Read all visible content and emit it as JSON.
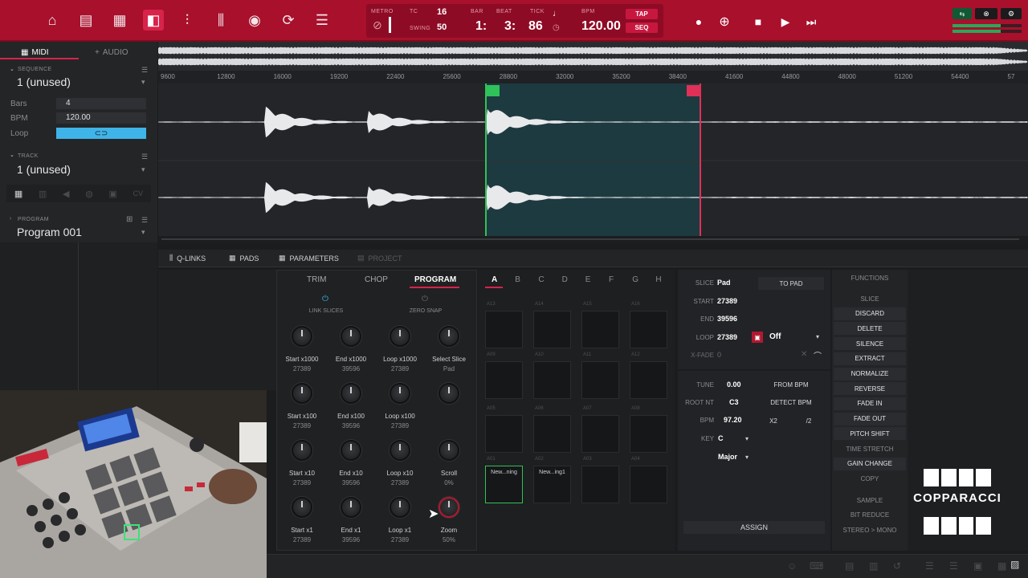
{
  "topbar": {
    "icons": [
      "home-icon",
      "browser-icon",
      "grid-icon",
      "sample-edit-icon",
      "mixer-icon",
      "channel-icon",
      "record-icon",
      "loop-icon",
      "list-icon"
    ],
    "transport": {
      "metro": "METRO",
      "tc": "TC",
      "tc_val": "16",
      "swing": "SWING",
      "swing_val": "50",
      "bar": "BAR",
      "beat": "BEAT",
      "tick": "TICK",
      "bar_val": "1:",
      "beat_val": "3:",
      "tick_val": "86",
      "bpm": "BPM",
      "bpm_val": "120.00",
      "tap": "TAP",
      "seq": "SEQ"
    }
  },
  "left": {
    "tab_midi": "MIDI",
    "tab_audio": "AUDIO",
    "sequence_label": "SEQUENCE",
    "sequence_value": "1 (unused)",
    "bars_label": "Bars",
    "bars_value": "4",
    "bpm_label": "BPM",
    "bpm_value": "120.00",
    "loop_label": "Loop",
    "track_label": "TRACK",
    "track_value": "1 (unused)",
    "program_label": "PROGRAM",
    "program_value": "Program 001"
  },
  "ruler": [
    "9600",
    "12800",
    "16000",
    "19200",
    "22400",
    "25600",
    "28800",
    "32000",
    "35200",
    "38400",
    "41600",
    "44800",
    "48000",
    "51200",
    "54400",
    "57"
  ],
  "lowtabs": {
    "qlinks": "Q-LINKS",
    "pads": "PADS",
    "parameters": "PARAMETERS",
    "project": "PROJECT"
  },
  "program": {
    "tabs": [
      "TRIM",
      "CHOP",
      "PROGRAM"
    ],
    "link_slices": "LINK SLICES",
    "zero_snap": "ZERO SNAP",
    "knobs": [
      {
        "label": "Start x1000",
        "value": "27389"
      },
      {
        "label": "End x1000",
        "value": "39596"
      },
      {
        "label": "Loop x1000",
        "value": "27389"
      },
      {
        "label": "Select Slice",
        "value": "Pad"
      },
      {
        "label": "Start x100",
        "value": "27389"
      },
      {
        "label": "End x100",
        "value": "39596"
      },
      {
        "label": "Loop x100",
        "value": "27389"
      },
      {
        "label": "",
        "value": ""
      },
      {
        "label": "Start x10",
        "value": "27389"
      },
      {
        "label": "End x10",
        "value": "39596"
      },
      {
        "label": "Loop x10",
        "value": "27389"
      },
      {
        "label": "Scroll",
        "value": "0%"
      },
      {
        "label": "Start x1",
        "value": "27389"
      },
      {
        "label": "End x1",
        "value": "39596"
      },
      {
        "label": "Loop x1",
        "value": "27389"
      },
      {
        "label": "Zoom",
        "value": "50%"
      }
    ]
  },
  "pads": {
    "banks": [
      "A",
      "B",
      "C",
      "D",
      "E",
      "F",
      "G",
      "H"
    ],
    "rows": [
      [
        "A13",
        "A14",
        "A15",
        "A16"
      ],
      [
        "A09",
        "A10",
        "A11",
        "A12"
      ],
      [
        "A05",
        "A06",
        "A07",
        "A08"
      ],
      [
        "A01",
        "A02",
        "A03",
        "A04"
      ]
    ],
    "a01_name": "New...ning",
    "a02_name": "New...ing1"
  },
  "slice": {
    "slice_label": "SLICE",
    "slice_value": "Pad",
    "to_pad": "TO PAD",
    "start_label": "START",
    "start_value": "27389",
    "end_label": "END",
    "end_value": "39596",
    "loop_label": "LOOP",
    "loop_value": "27389",
    "loop_mode": "Off",
    "xfade_label": "X-FADE",
    "xfade_value": "0",
    "tune_label": "TUNE",
    "tune_value": "0.00",
    "from_bpm": "FROM BPM",
    "rootnt_label": "ROOT NT",
    "rootnt_value": "C3",
    "detect_bpm": "DETECT BPM",
    "bpm_label": "BPM",
    "bpm_value": "97.20",
    "x2": "X2",
    "div2": "/2",
    "key_label": "KEY",
    "key_value": "C",
    "scale_value": "Major",
    "assign": "ASSIGN"
  },
  "functions": {
    "title": "FUNCTIONS",
    "items": [
      "SLICE",
      "DISCARD",
      "DELETE",
      "SILENCE",
      "EXTRACT",
      "NORMALIZE",
      "REVERSE",
      "FADE IN",
      "FADE OUT",
      "PITCH SHIFT",
      "TIME STRETCH",
      "GAIN CHANGE",
      "COPY",
      "SAMPLE",
      "BIT REDUCE",
      "STEREO > MONO"
    ]
  },
  "watermark": "COPPARACCI",
  "colors": {
    "accent": "#a8102c",
    "active_tab": "#d8234a",
    "loop_blue": "#3fb4e8",
    "selection": "#1d3a40",
    "start_marker": "#2fc25a",
    "end_marker": "#e03058"
  }
}
